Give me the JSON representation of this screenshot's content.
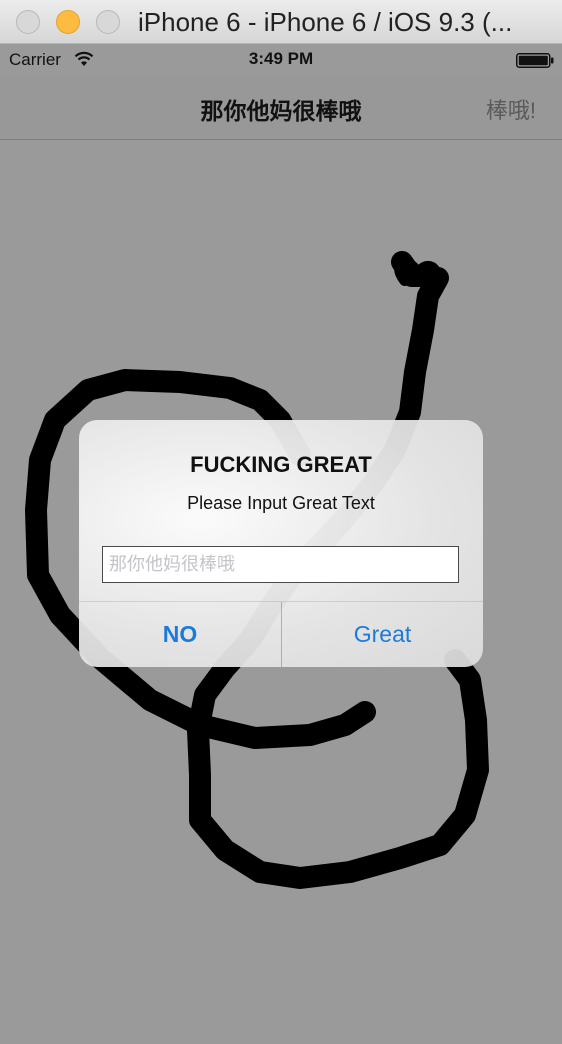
{
  "window": {
    "title": "iPhone 6 - iPhone 6 / iOS 9.3 (..."
  },
  "status_bar": {
    "carrier": "Carrier",
    "time": "3:49 PM",
    "wifi_icon": "wifi-icon",
    "battery_icon": "battery-full-icon"
  },
  "nav_bar": {
    "title": "那你他妈很棒哦",
    "right_button": "棒哦!"
  },
  "alert": {
    "title": "FUCKING GREAT",
    "message": "Please Input Great Text",
    "input_value": "",
    "input_placeholder": "那你他妈很棒哦",
    "buttons": {
      "no": "NO",
      "great": "Great"
    },
    "button_color": "#1a7bd8"
  },
  "colors": {
    "background": "#9a9a9a",
    "stroke": "#000000"
  }
}
